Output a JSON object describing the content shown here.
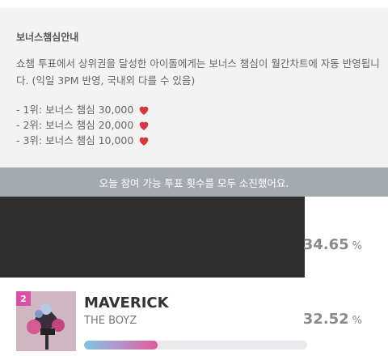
{
  "notice": {
    "title": "보너스챔심안내",
    "body": "쇼챔 투표에서 상위권을 달성한 아이돌에게는 보너스 챔심이 월간차트에 자동 반영됩니다. (익일 3PM 반영, 국내외 다를 수 있음)",
    "bonuses": [
      "- 1위: 보너스 챔심 30,000",
      "- 2위: 보너스 챔심 20,000",
      "- 3위: 보너스 챔심 10,000"
    ]
  },
  "banner": "오늘 참여 가능 투표 횟수를 모두 소진했어요.",
  "rankings": [
    {
      "percent": "34.65",
      "unit": "%"
    },
    {
      "rank": "2",
      "song": "MAVERICK",
      "artist": "THE BOYZ",
      "percent": "32.52",
      "unit": "%",
      "progress": 0.33
    }
  ],
  "colors": {
    "heart": "#d9363e",
    "badge": "#d94fa6",
    "banner": "#a5aab1"
  }
}
